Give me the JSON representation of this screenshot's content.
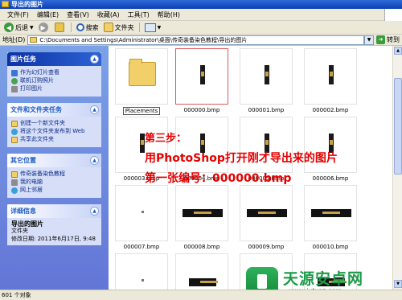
{
  "window": {
    "title": "导出的图片"
  },
  "menu": [
    "文件(F)",
    "编辑(E)",
    "查看(V)",
    "收藏(A)",
    "工具(T)",
    "帮助(H)"
  ],
  "toolbar": {
    "back": "后退",
    "search": "搜索",
    "folders": "文件夹"
  },
  "address": {
    "label": "地址(D)",
    "path": "C:\\Documents and Settings\\Administrator\\桌面\\传奇装备染色教程\\导出的图片",
    "go": "转到"
  },
  "left_pane": {
    "picture_tasks": {
      "title": "图片任务",
      "items": [
        "作为幻灯片查看",
        "联机订购照片",
        "打印图片"
      ]
    },
    "file_tasks": {
      "title": "文件和文件夹任务",
      "items": [
        "创建一个新文件夹",
        "将这个文件夹发布到 Web",
        "共享此文件夹"
      ]
    },
    "other_places": {
      "title": "其它位置",
      "items": [
        "传奇装备染色教程",
        "我的电脑",
        "网上邻居"
      ]
    },
    "details": {
      "title": "详细信息",
      "name": "导出的图片",
      "type": "文件夹",
      "modified": "修改日期: 2011年6月17日, 9:48"
    }
  },
  "files": [
    {
      "name": "Placements",
      "kind": "folder"
    },
    {
      "name": "000000.bmp",
      "kind": "tall",
      "selected": true
    },
    {
      "name": "000001.bmp",
      "kind": "tall"
    },
    {
      "name": "000002.bmp",
      "kind": "tall"
    },
    {
      "name": "000003.bmp",
      "kind": "tall"
    },
    {
      "name": "000004.bmp",
      "kind": "tall"
    },
    {
      "name": "000005.bmp",
      "kind": "tall"
    },
    {
      "name": "000006.bmp",
      "kind": "tall"
    },
    {
      "name": "000007.bmp",
      "kind": "dot"
    },
    {
      "name": "000008.bmp",
      "kind": "wide"
    },
    {
      "name": "000009.bmp",
      "kind": "wide"
    },
    {
      "name": "000010.bmp",
      "kind": "wide"
    },
    {
      "name": "",
      "kind": "dot"
    },
    {
      "name": "",
      "kind": "wide"
    },
    {
      "name": "",
      "kind": "dot"
    },
    {
      "name": "",
      "kind": "wide"
    }
  ],
  "overlay": {
    "line1": "第三步：",
    "line2": "用PhotoShop打开刚才导出来的图片",
    "line3": "第一张编号：000000.bmp"
  },
  "watermark": {
    "title": "天源安卓网",
    "url": "www.jytyaz.com"
  },
  "status": {
    "text": "601 个对象"
  },
  "colors": {
    "overlay_text": "#e50000",
    "xp_blue": "#0a3fb3",
    "selection": "#d85a5a"
  }
}
